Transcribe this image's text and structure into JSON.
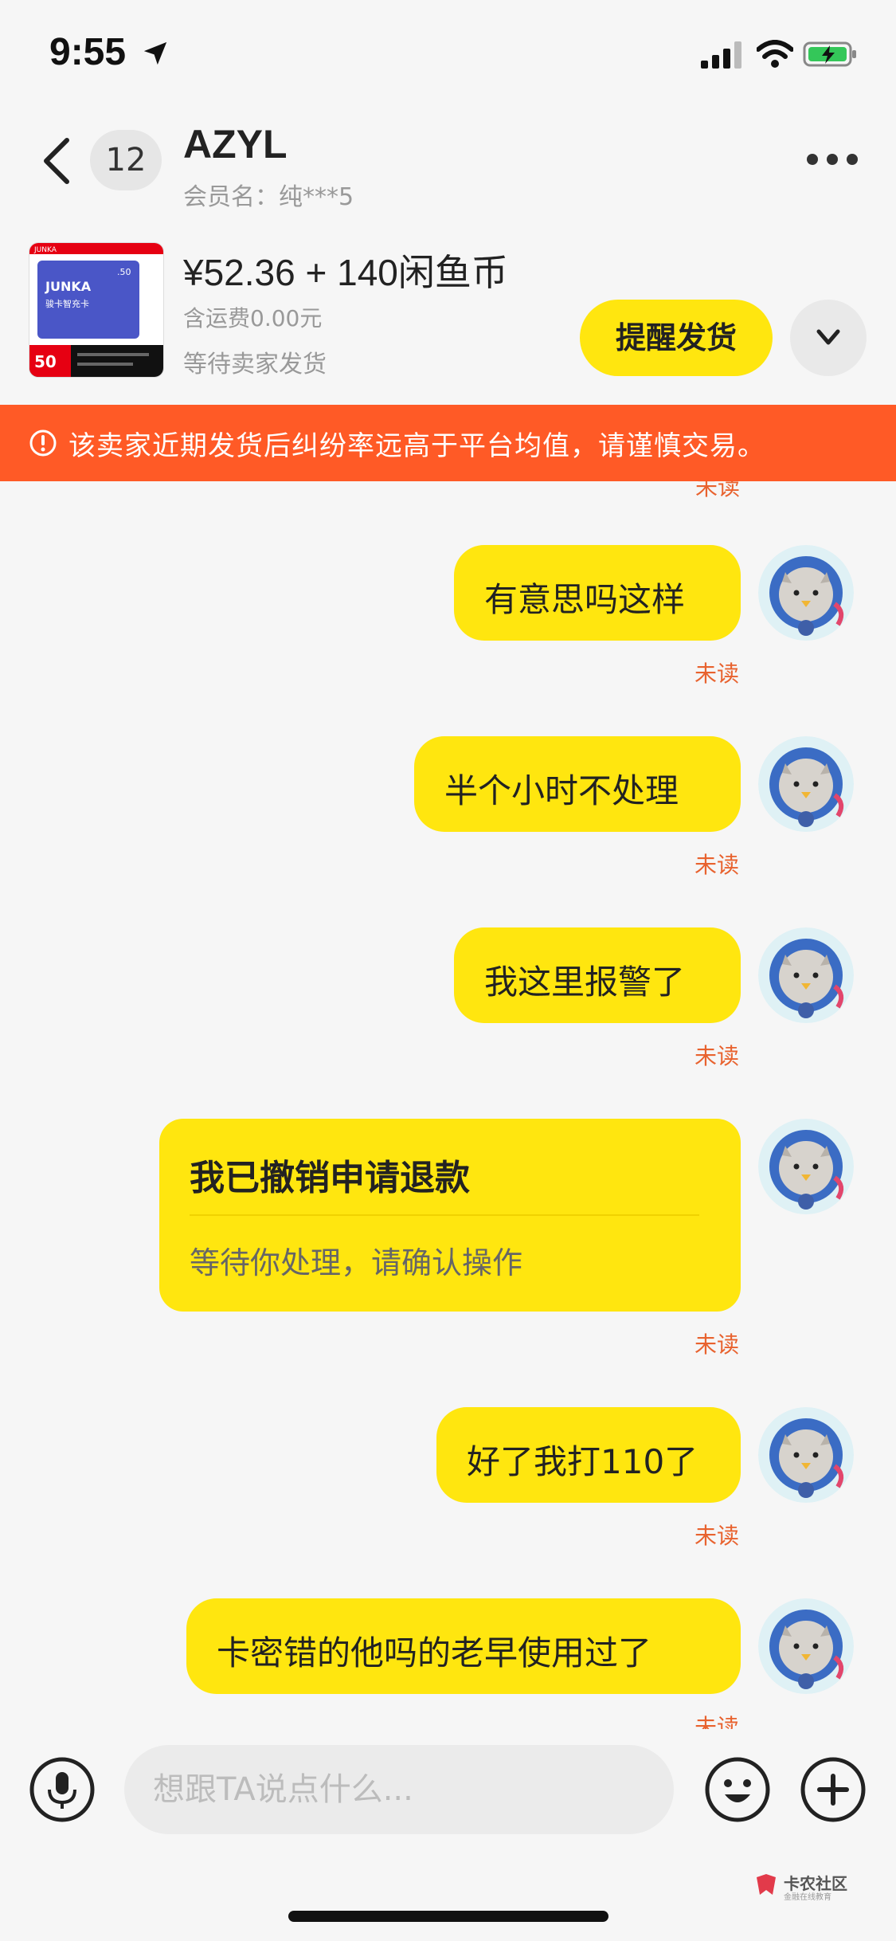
{
  "status_bar": {
    "time": "9:55",
    "icons": [
      "location-arrow-icon",
      "cellular-signal-icon",
      "wifi-icon",
      "battery-charging-icon"
    ]
  },
  "header": {
    "unread_count": "12",
    "name": "AZYL",
    "member_line": "会员名：纯***5"
  },
  "product": {
    "thumbnail": {
      "brand": "JUNKA",
      "card_name": "JUNKA",
      "card_sub": "骏卡智充卡",
      "value": "50",
      "value_small": ".50"
    },
    "price": "¥52.36 + 140闲鱼币",
    "shipping": "含运费0.00元",
    "status": "等待卖家发货",
    "remind_button": "提醒发货"
  },
  "warning": {
    "text": "该卖家近期发货后纠纷率远高于平台均值，请谨慎交易。"
  },
  "messages": [
    {
      "text": "有意思吗这样",
      "status": "未读"
    },
    {
      "text": "半个小时不处理",
      "status": "未读"
    },
    {
      "text": "我这里报警了",
      "status": "未读"
    },
    {
      "title": "我已撤销申请退款",
      "subtitle": "等待你处理，请确认操作",
      "status": "未读"
    },
    {
      "text": "好了我打110了",
      "status": "未读"
    },
    {
      "text": "卡密错的他吗的老早使用过了",
      "status": "未读"
    }
  ],
  "top_partial_status": "未读",
  "input": {
    "placeholder": "想跟TA说点什么..."
  },
  "watermark": {
    "text": "卡农社区",
    "sub": "金融在线教育"
  },
  "colors": {
    "bubble": "#ffe60f",
    "warning_bg": "#ff5a26",
    "unread_text": "#e8622e",
    "background": "#f6f6f6"
  }
}
